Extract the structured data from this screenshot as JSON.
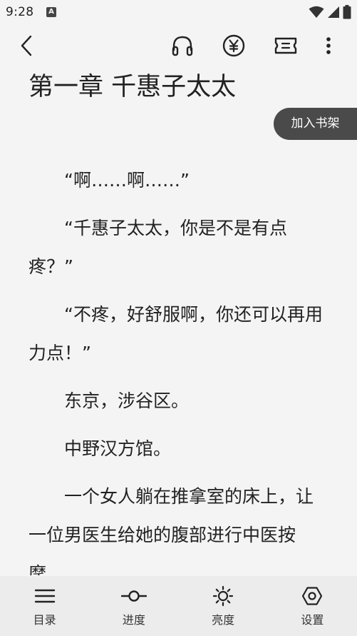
{
  "status_bar": {
    "time": "9:28",
    "notification_icon_letter": "A",
    "icons": [
      "wifi-icon",
      "signal-icon",
      "battery-icon"
    ]
  },
  "app_bar": {
    "icons": [
      "back-icon",
      "headphones-icon",
      "yen-icon",
      "ticket-icon",
      "more-icon"
    ]
  },
  "chapter": {
    "title": "第一章 千惠子太太",
    "add_to_shelf_label": "加入书架",
    "paragraphs": [
      "“啊……啊……”",
      "“千惠子太太，你是不是有点疼？”",
      "“不疼，好舒服啊，你还可以再用力点！”",
      "东京，涉谷区。",
      "中野汉方馆。",
      "一个女人躺在推拿室的床上，让一位男医生给她的腹部进行中医按摩。"
    ]
  },
  "bottom_nav": {
    "items": [
      {
        "label": "目录",
        "icon": "menu-icon"
      },
      {
        "label": "进度",
        "icon": "progress-icon"
      },
      {
        "label": "亮度",
        "icon": "brightness-icon"
      },
      {
        "label": "设置",
        "icon": "settings-icon"
      }
    ]
  },
  "colors": {
    "background": "#f4f4f4",
    "text": "#222222",
    "shelf_button": "#4a4a4a",
    "bottom_nav": "#ececec"
  }
}
